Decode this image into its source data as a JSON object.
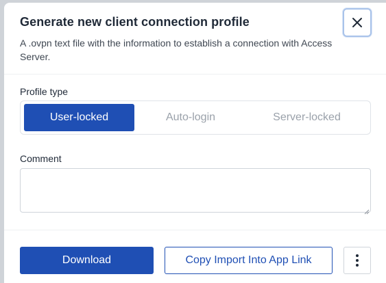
{
  "dialog": {
    "title": "Generate new client connection profile",
    "subtitle": "A .ovpn text file with the information to establish a connection with Access Server.",
    "close_icon": "close-icon"
  },
  "profile_type": {
    "label": "Profile type",
    "options": [
      "User-locked",
      "Auto-login",
      "Server-locked"
    ],
    "selected": "User-locked"
  },
  "comment": {
    "label": "Comment",
    "value": "",
    "placeholder": ""
  },
  "footer": {
    "download_label": "Download",
    "copy_link_label": "Copy Import Into App Link",
    "more_icon": "more-vertical-icon"
  },
  "colors": {
    "accent": "#1f4fb4",
    "focus_ring": "#a9c3ea",
    "muted_text": "#9aa1aa"
  }
}
